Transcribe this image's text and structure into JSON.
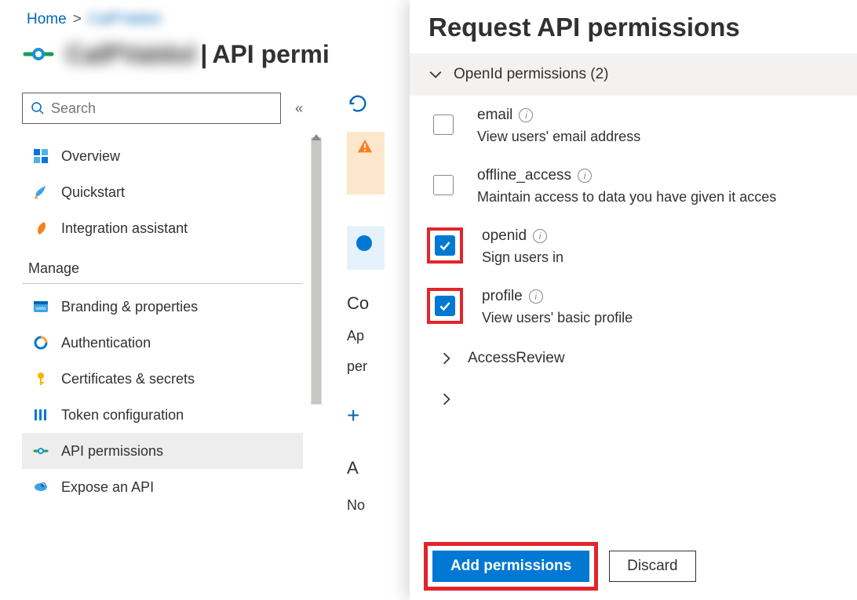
{
  "breadcrumb": {
    "home": "Home",
    "app": "CalPValdol"
  },
  "pageTitle": {
    "sep": " | ",
    "section_prefix": "API permi"
  },
  "search": {
    "placeholder": "Search"
  },
  "sidebar": {
    "items": [
      {
        "label": "Overview"
      },
      {
        "label": "Quickstart"
      },
      {
        "label": "Integration assistant"
      }
    ],
    "manageHeader": "Manage",
    "manage": [
      {
        "label": "Branding & properties"
      },
      {
        "label": "Authentication"
      },
      {
        "label": "Certificates & secrets"
      },
      {
        "label": "Token configuration"
      },
      {
        "label": "API permissions"
      },
      {
        "label": "Expose an API"
      }
    ]
  },
  "main": {
    "config": "Co",
    "body1": "Ap",
    "body2": "per",
    "apiHead": "A",
    "noText": "No"
  },
  "panel": {
    "title": "Request API permissions",
    "groupHeader": "OpenId permissions (2)",
    "perms": [
      {
        "name": "email",
        "desc": "View users' email address",
        "checked": false,
        "highlight": false
      },
      {
        "name": "offline_access",
        "desc": "Maintain access to data you have given it acces",
        "checked": false,
        "highlight": false
      },
      {
        "name": "openid",
        "desc": "Sign users in",
        "checked": true,
        "highlight": true
      },
      {
        "name": "profile",
        "desc": "View users' basic profile",
        "checked": true,
        "highlight": true
      }
    ],
    "collapsed": "AccessReview",
    "actions": {
      "add": "Add permissions",
      "discard": "Discard"
    }
  }
}
